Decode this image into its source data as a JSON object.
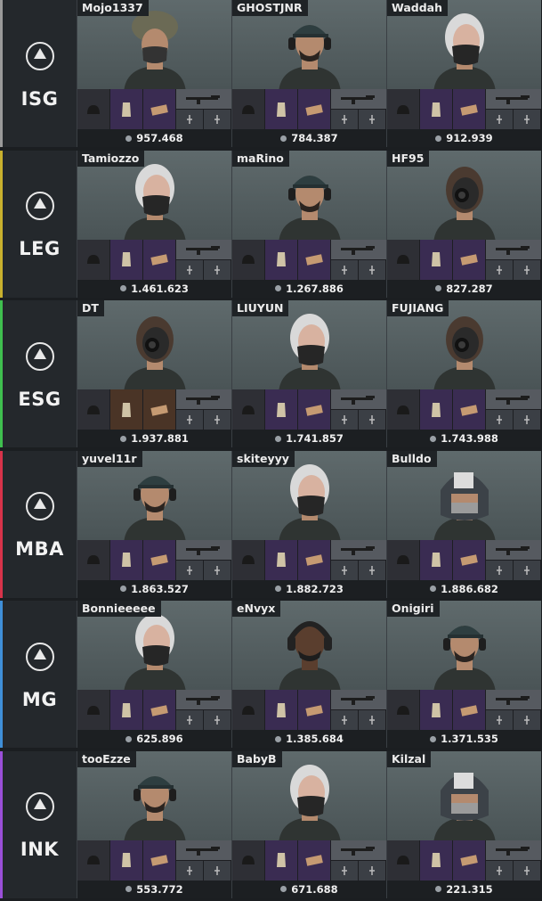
{
  "teams": [
    {
      "tag": "ISG",
      "accent": "#9a9a9a",
      "players": [
        {
          "name": "Mojo1337",
          "score": "957.468",
          "model": "tactical",
          "loadout": "purple"
        },
        {
          "name": "GHOSTJNR",
          "score": "784.387",
          "model": "cap",
          "loadout": "purple"
        },
        {
          "name": "Waddah",
          "score": "912.939",
          "model": "gray",
          "loadout": "purple"
        }
      ]
    },
    {
      "tag": "LEG",
      "accent": "#c8b02e",
      "players": [
        {
          "name": "Tamiozzo",
          "score": "1.461.623",
          "model": "gray",
          "loadout": "purple"
        },
        {
          "name": "maRino",
          "score": "1.267.886",
          "model": "cap",
          "loadout": "purple"
        },
        {
          "name": "HF95",
          "score": "827.287",
          "model": "nvg",
          "loadout": "purple"
        }
      ]
    },
    {
      "tag": "ESG",
      "accent": "#3fbf4f",
      "players": [
        {
          "name": "DT",
          "score": "1.937.881",
          "model": "nvg",
          "loadout": "amber"
        },
        {
          "name": "LIUYUN",
          "score": "1.741.857",
          "model": "gray",
          "loadout": "purple"
        },
        {
          "name": "FUJIANG",
          "score": "1.743.988",
          "model": "nvg",
          "loadout": "purple"
        }
      ]
    },
    {
      "tag": "MBA",
      "accent": "#d8334a",
      "players": [
        {
          "name": "yuvel11r",
          "score": "1.863.527",
          "model": "cap",
          "loadout": "purple"
        },
        {
          "name": "skiteyyy",
          "score": "1.882.723",
          "model": "gray",
          "loadout": "purple"
        },
        {
          "name": "Bulldo",
          "score": "1.886.682",
          "model": "helmet",
          "loadout": "purple"
        }
      ]
    },
    {
      "tag": "MG",
      "accent": "#3f8fd8",
      "players": [
        {
          "name": "Bonnieeeee",
          "score": "625.896",
          "model": "gray",
          "loadout": "purple"
        },
        {
          "name": "eNvyx",
          "score": "1.385.684",
          "model": "headset",
          "loadout": "purple"
        },
        {
          "name": "Onigiri",
          "score": "1.371.535",
          "model": "cap",
          "loadout": "purple"
        }
      ]
    },
    {
      "tag": "INK",
      "accent": "#9a4fd8",
      "players": [
        {
          "name": "tooEzze",
          "score": "553.772",
          "model": "cap",
          "loadout": "purple"
        },
        {
          "name": "BabyB",
          "score": "671.688",
          "model": "gray",
          "loadout": "purple"
        },
        {
          "name": "Kilzal",
          "score": "221.315",
          "model": "helmet",
          "loadout": "purple"
        }
      ]
    }
  ],
  "icons": {
    "helmet": "helmet-icon",
    "vest": "vest-icon",
    "backpack": "backpack-icon",
    "rifle": "rifle-icon",
    "coin": "coin-icon"
  }
}
